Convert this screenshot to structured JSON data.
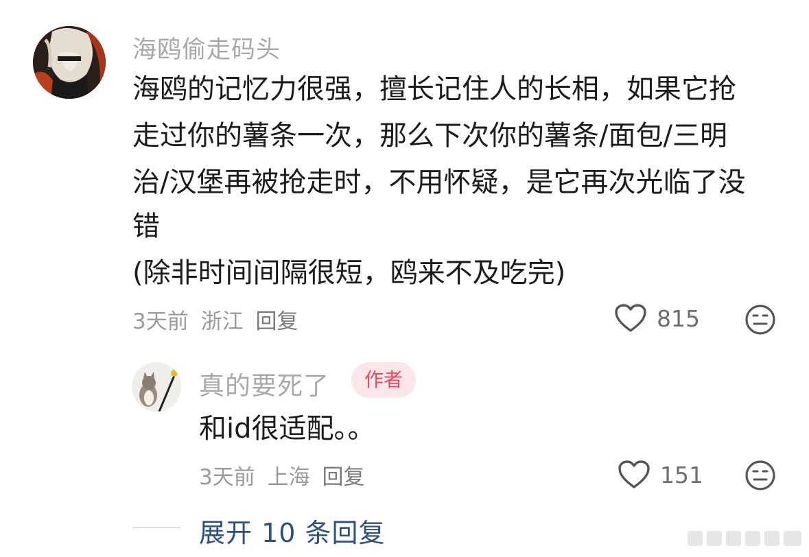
{
  "comment": {
    "author": "海鸥偷走码头",
    "lines": [
      "海鸥的记忆力很强，擅长记住人的长相，如果它抢",
      "走过你的薯条一次，那么下次你的薯条/面包/三明",
      "治/汉堡再被抢走时，不用怀疑，是它再次光临了没",
      "错",
      "(除非时间间隔很短，鸥来不及吃完)"
    ],
    "time": "3天前",
    "location": "浙江",
    "reply_label": "回复",
    "like_count": "815",
    "icons": {
      "like": "heart-icon",
      "dislike": "meh-face-icon"
    }
  },
  "reply": {
    "author": "真的要死了",
    "tag": "作者",
    "text": "和id很适配。。",
    "time": "3天前",
    "location": "上海",
    "reply_label": "回复",
    "like_count": "151",
    "icons": {
      "like": "heart-icon",
      "dislike": "meh-face-icon"
    }
  },
  "expand": {
    "label": "展开 10 条回复"
  },
  "colors": {
    "tag_bg": "#fbe7ea",
    "tag_text": "#e84a5f",
    "expand_text": "#2f4f7f"
  }
}
